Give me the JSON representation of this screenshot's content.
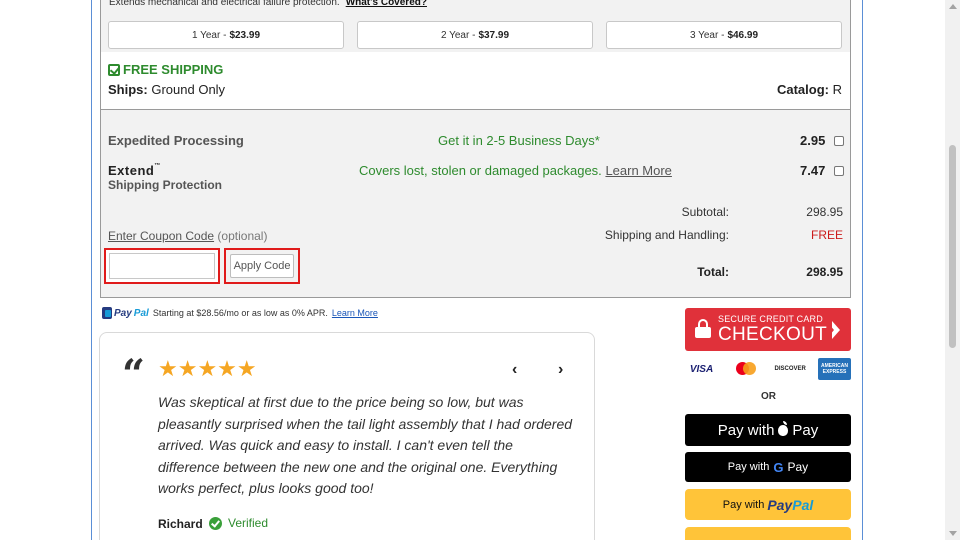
{
  "warranty": {
    "description": "Extends mechanical and electrical failure protection.",
    "link": "What's Covered?",
    "plans": [
      {
        "term": "1 Year - ",
        "price": "$23.99"
      },
      {
        "term": "2 Year - ",
        "price": "$37.99"
      },
      {
        "term": "3 Year - ",
        "price": "$46.99"
      }
    ]
  },
  "shipping": {
    "free_label": "FREE SHIPPING",
    "ships_label": "Ships:",
    "ships_value": "Ground Only",
    "catalog_label": "Catalog:",
    "catalog_value": "R"
  },
  "options": {
    "expedited_label": "Expedited Processing",
    "expedited_desc": "Get it in 2-5 Business Days*",
    "expedited_price": "2.95",
    "extend_brand": "Extend",
    "extend_tm": "™",
    "extend_label": "Shipping Protection",
    "extend_desc": "Covers lost, stolen or damaged packages.",
    "extend_link": "Learn More",
    "extend_price": "7.47"
  },
  "summary": {
    "subtotal_label": "Subtotal:",
    "subtotal_value": "298.95",
    "shipping_label": "Shipping and Handling:",
    "shipping_value": "FREE",
    "total_label": "Total:",
    "total_value": "298.95"
  },
  "coupon": {
    "label": "Enter Coupon Code",
    "optional": "(optional)",
    "input_value": "",
    "button": "Apply Code"
  },
  "paypal_credit": {
    "brand_pay": "Pay",
    "brand_pal": "Pal",
    "text": "Starting at $28.56/mo or as low as 0% APR.",
    "link": "Learn More"
  },
  "review": {
    "quote_mark": "“",
    "stars": "★★★★★",
    "rating": 5,
    "prev": "‹",
    "next": "›",
    "text": "Was skeptical at first due to the price being so low, but was pleasantly surprised when the tail light assembly that I had ordered arrived. Was quick and easy to install. I can't even tell the difference between the new one and the original one. Everything works perfect, plus looks good too!",
    "reviewer": "Richard",
    "verified": "Verified"
  },
  "checkout": {
    "top_label": "SECURE CREDIT CARD",
    "main_label": "CHECKOUT",
    "cards": [
      "VISA",
      "DISCOVER",
      "AMERICAN EXPRESS"
    ],
    "or": "OR",
    "apple_pay_prefix": "Pay with",
    "apple_pay_word": "Pay",
    "google_pay_prefix": "Pay with",
    "google_pay_g": "G",
    "google_pay_word": "Pay",
    "paypal_prefix": "Pay with",
    "paypal_pay": "Pay",
    "paypal_pal": "Pal"
  },
  "colors": {
    "accent_red": "#e0313a",
    "success_green": "#2e8b2e",
    "paypal_yellow": "#ffc439",
    "highlight_red": "#e01b1b"
  }
}
